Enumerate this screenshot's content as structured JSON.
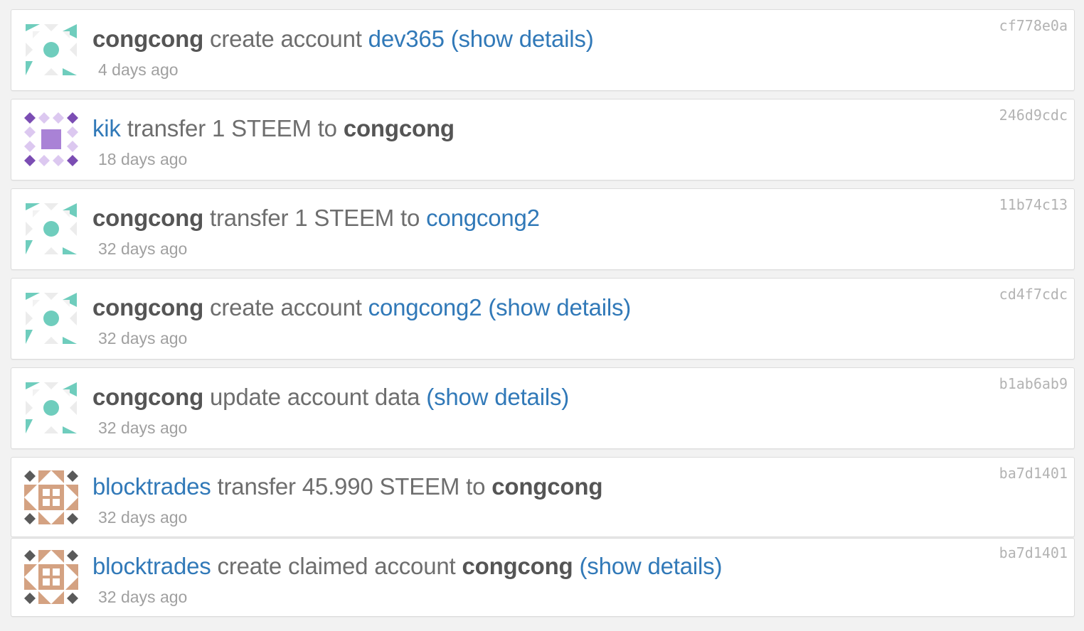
{
  "feed": {
    "items": [
      {
        "avatar": "identicon-teal",
        "actor": "congcong",
        "verb": "create account",
        "target": "dev365",
        "details": "(show details)",
        "time": "4 days ago",
        "hash": "cf778e0a"
      },
      {
        "avatar": "identicon-purple",
        "actor": "kik",
        "verb": "transfer 1 STEEM to",
        "target": "congcong",
        "details": "",
        "time": "18 days ago",
        "hash": "246d9cdc"
      },
      {
        "avatar": "identicon-teal",
        "actor": "congcong",
        "verb": "transfer 1 STEEM to",
        "target": "congcong2",
        "details": "",
        "time": "32 days ago",
        "hash": "11b74c13"
      },
      {
        "avatar": "identicon-teal",
        "actor": "congcong",
        "verb": "create account",
        "target": "congcong2",
        "details": "(show details)",
        "time": "32 days ago",
        "hash": "cd4f7cdc"
      },
      {
        "avatar": "identicon-teal",
        "actor": "congcong",
        "verb": "update account data",
        "target": "",
        "details": "(show details)",
        "time": "32 days ago",
        "hash": "b1ab6ab9"
      },
      {
        "avatar": "identicon-brown",
        "actor": "blocktrades",
        "verb": "transfer 45.990 STEEM to",
        "target": "congcong",
        "details": "",
        "time": "32 days ago",
        "hash": "ba7d1401"
      },
      {
        "avatar": "identicon-brown",
        "actor": "blocktrades",
        "verb": "create claimed account",
        "target": "congcong",
        "details": "(show details)",
        "time": "32 days ago",
        "hash": "ba7d1401"
      }
    ]
  },
  "colors": {
    "link": "#3179b8",
    "strong_user": "#555555",
    "text": "#6e6e6e",
    "muted": "#a0a0a0",
    "teal": "#6fcdbd",
    "purple": "#a982d6",
    "brown": "#d4a282"
  }
}
